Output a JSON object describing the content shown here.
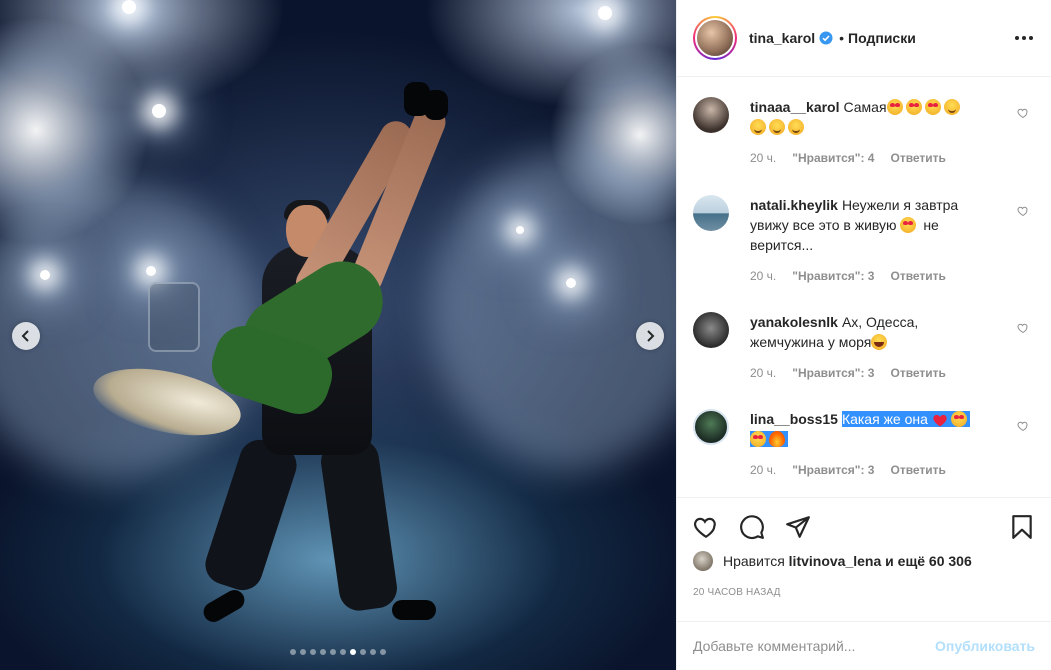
{
  "post": {
    "author": "tina_karol",
    "separator": "•",
    "follow_label": "Подписки",
    "verified": true
  },
  "media": {
    "slide_count": 10,
    "active_slide": 7,
    "icons": {
      "prev": "chevron-left-icon",
      "next": "chevron-right-icon"
    }
  },
  "comments": [
    {
      "user": "tinaaa__karol",
      "text": "Самая",
      "emojis": [
        "heart-eyes",
        "heart-eyes",
        "heart-eyes",
        "smile",
        "smile",
        "smile",
        "smile"
      ],
      "time": "20 ч.",
      "likes": "\"Нравится\": 4",
      "reply": "Ответить"
    },
    {
      "user": "natali.kheylik",
      "text_before": "Неужели я завтра увижу все это в живую",
      "text_after": "не верится...",
      "emojis": [
        "heart-eyes"
      ],
      "time": "20 ч.",
      "likes": "\"Нравится\": 3",
      "reply": "Ответить"
    },
    {
      "user": "yanakolesnlk",
      "text": "Ах, Одесса, жемчужина у моря",
      "emojis": [
        "laugh"
      ],
      "time": "20 ч.",
      "likes": "\"Нравится\": 3",
      "reply": "Ответить"
    },
    {
      "user": "lina__boss15",
      "text": "Какая же она",
      "emojis": [
        "red-heart",
        "heart-eyes",
        "heart-eyes",
        "fire"
      ],
      "selected": true,
      "time": "20 ч.",
      "likes": "\"Нравится\": 3",
      "reply": "Ответить"
    }
  ],
  "actions": {
    "icons": [
      "heart-icon",
      "comment-icon",
      "share-icon",
      "bookmark-icon"
    ]
  },
  "likes_summary": {
    "prefix": "Нравится",
    "user": "litvinova_lena",
    "suffix": "и ещё 60 306"
  },
  "time_ago": "20 ЧАСОВ НАЗАД",
  "add_comment": {
    "placeholder": "Добавьте комментарий...",
    "publish_label": "Опубликовать"
  },
  "colors": {
    "text": "#262626",
    "muted": "#8e8e8e",
    "publish_disabled": "#b2dffc",
    "verified": "#3897f0",
    "selection": "#3390ff"
  }
}
